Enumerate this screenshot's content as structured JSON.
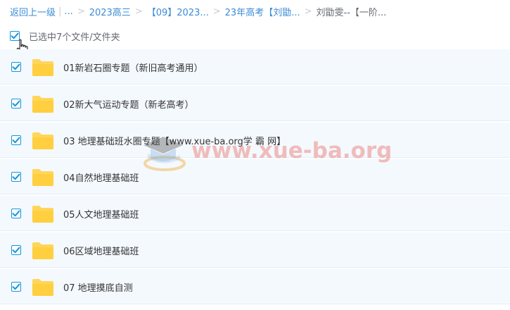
{
  "breadcrumb": {
    "back": "返回上一级",
    "ellipsis": "...",
    "items": [
      "2023高三",
      "【09】2023...",
      "23年高考【刘勖..."
    ],
    "current": "刘勖雯--【一阶..."
  },
  "selection": {
    "text": "已选中7个文件/文件夹",
    "all_checked": true
  },
  "folders": [
    {
      "name": "01新岩石圈专题（新旧高考通用）",
      "checked": true
    },
    {
      "name": "02新大气运动专题（新老高考）",
      "checked": true
    },
    {
      "name": "03 地理基础班水圈专题【www.xue-ba.org学 霸 网】",
      "checked": true
    },
    {
      "name": "04自然地理基础班",
      "checked": true
    },
    {
      "name": "05人文地理基础班",
      "checked": true
    },
    {
      "name": "06区域地理基础班",
      "checked": true
    },
    {
      "name": "07 地理摸底自测",
      "checked": true
    }
  ],
  "watermark": {
    "text": "www.xue-ba.org"
  },
  "colors": {
    "accent": "#1296db",
    "link": "#3b8cd6",
    "row_bg": "#f4f9fe",
    "folder": "#ffd659"
  }
}
